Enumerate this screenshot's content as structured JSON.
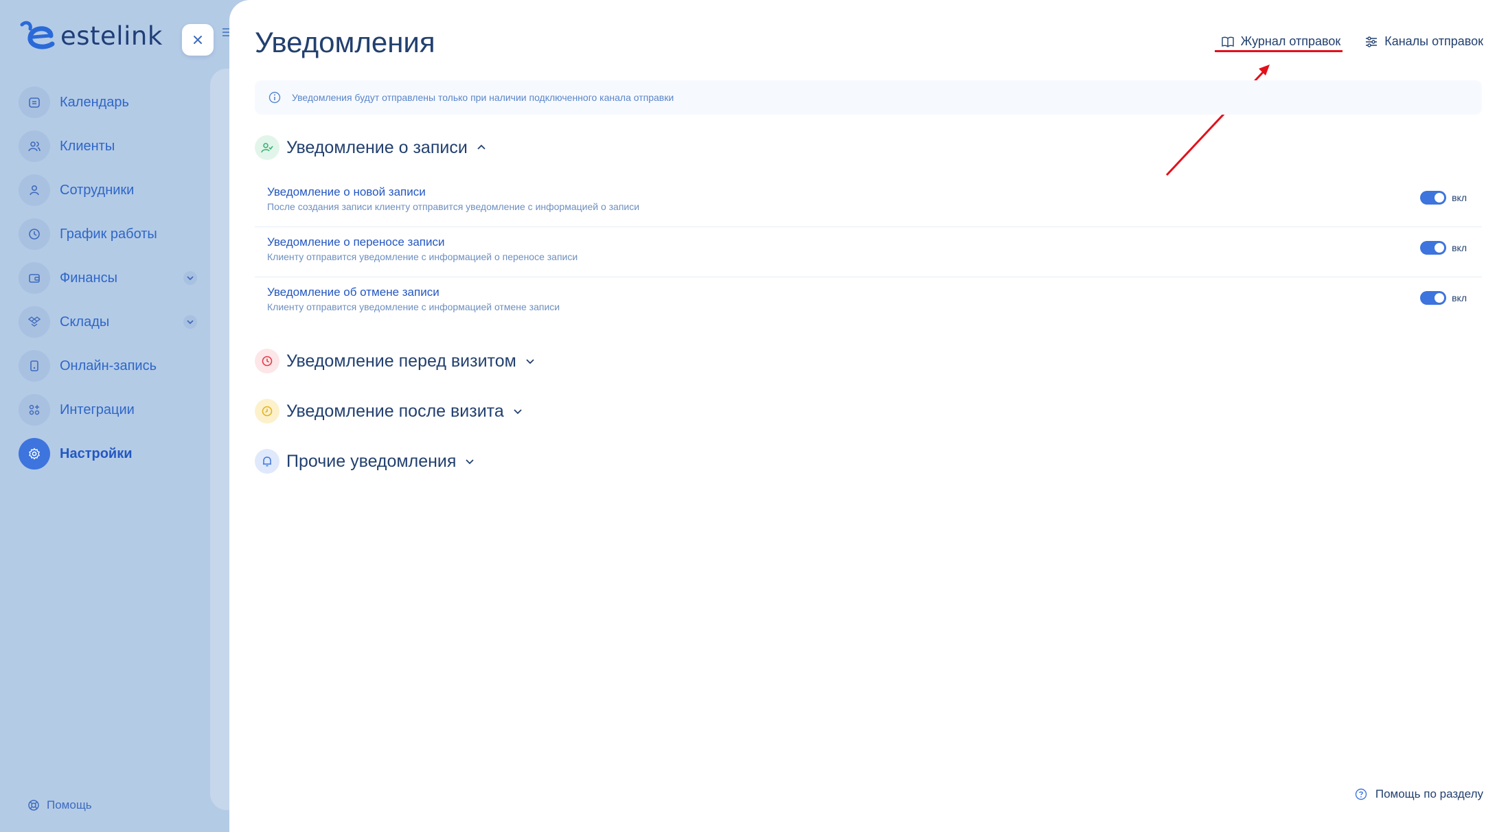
{
  "sidebar": {
    "logo_text": "estelink",
    "items": [
      {
        "label": "Календарь",
        "icon": "calendar-icon"
      },
      {
        "label": "Клиенты",
        "icon": "clients-icon"
      },
      {
        "label": "Сотрудники",
        "icon": "employee-icon"
      },
      {
        "label": "График работы",
        "icon": "clock-icon"
      },
      {
        "label": "Финансы",
        "icon": "wallet-icon",
        "expandable": true
      },
      {
        "label": "Склады",
        "icon": "boxes-icon",
        "expandable": true
      },
      {
        "label": "Онлайн-запись",
        "icon": "phone-icon"
      },
      {
        "label": "Интеграции",
        "icon": "grid-plus-icon"
      },
      {
        "label": "Настройки",
        "icon": "gear-icon",
        "active": true
      }
    ],
    "help_label": "Помощь"
  },
  "main": {
    "title": "Уведомления",
    "links": {
      "journal": "Журнал отправок",
      "channels": "Каналы отправок"
    },
    "info_text": "Уведомления будут отправлены только при наличии подключенного канала отправки",
    "sections": [
      {
        "title": "Уведомление о записи",
        "expanded": true,
        "color": "#3bb273",
        "rows": [
          {
            "title": "Уведомление о новой записи",
            "desc": "После создания записи клиенту отправится уведомление с информацией о записи",
            "toggle": "вкл"
          },
          {
            "title": "Уведомление о переносе записи",
            "desc": "Клиенту отправится уведомление с информацией о переносе записи",
            "toggle": "вкл"
          },
          {
            "title": "Уведомление об отмене записи",
            "desc": "Клиенту отправится уведомление с информацией отмене записи",
            "toggle": "вкл"
          }
        ]
      },
      {
        "title": "Уведомление перед визитом",
        "expanded": false,
        "color": "#e23b4a"
      },
      {
        "title": "Уведомление после визита",
        "expanded": false,
        "color": "#e3b21e"
      },
      {
        "title": "Прочие уведомления",
        "expanded": false,
        "color": "#3d74dd"
      }
    ],
    "help_section": "Помощь по разделу"
  },
  "colors": {
    "accent": "#3d74dd",
    "annotation_red": "#e3101b"
  }
}
